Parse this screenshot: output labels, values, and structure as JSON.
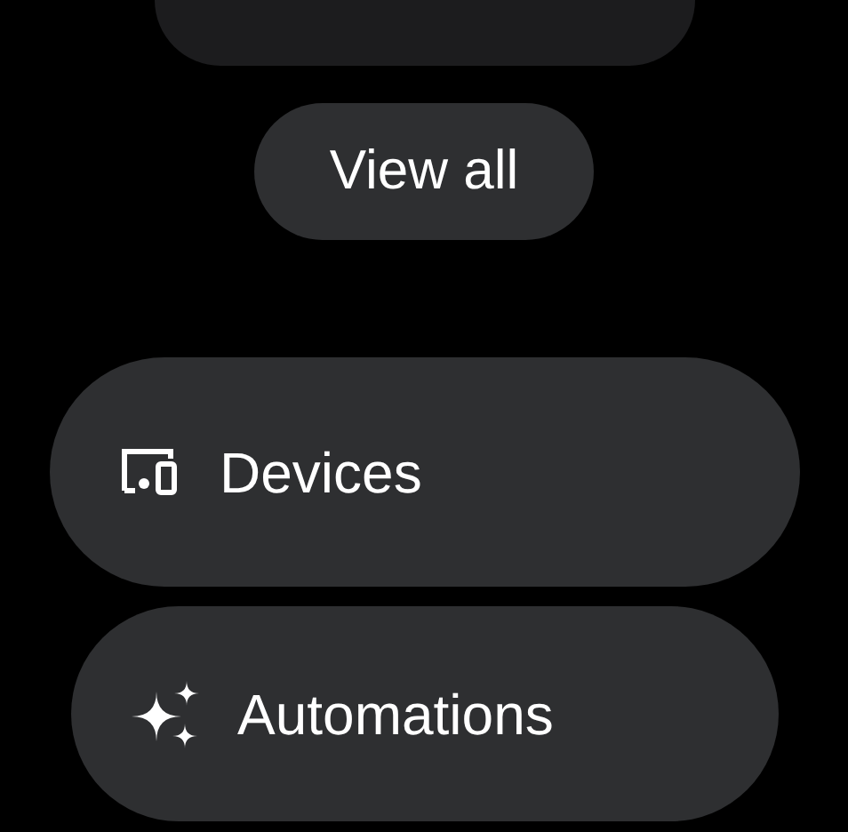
{
  "view_all_button": {
    "label": "View all"
  },
  "menu_items": [
    {
      "kind": "devices",
      "label": "Devices"
    },
    {
      "kind": "automations",
      "label": "Automations"
    }
  ]
}
